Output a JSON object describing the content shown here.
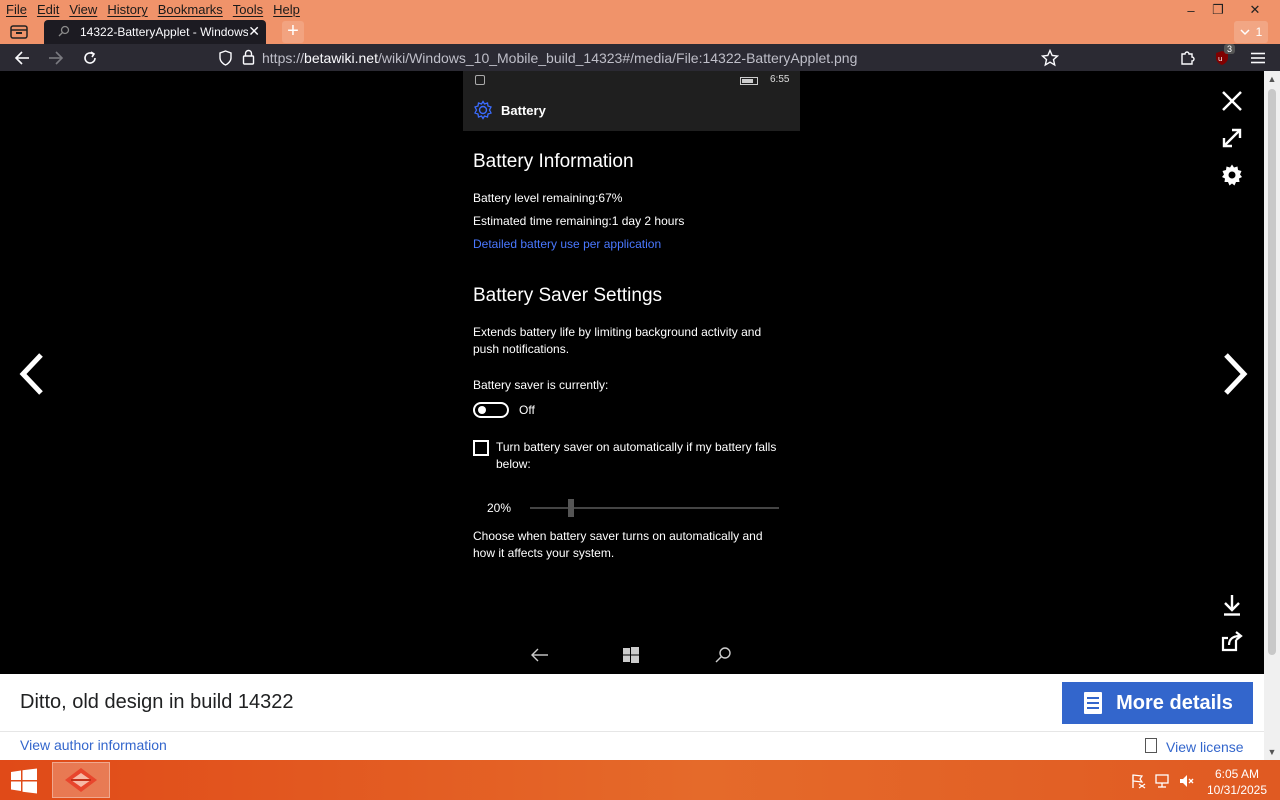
{
  "menubar": {
    "items": [
      "File",
      "Edit",
      "View",
      "History",
      "Bookmarks",
      "Tools",
      "Help"
    ]
  },
  "window_controls": {
    "minimize": "–",
    "restore": "❐",
    "close": "✕"
  },
  "tabs": [
    {
      "title": "14322-BatteryApplet - Windows",
      "close": "✕"
    }
  ],
  "new_tab_label": "+",
  "tab_count": "1",
  "nav": {
    "url_prefix": "https://",
    "url_domain": "betawiki.net",
    "url_path": "/wiki/Windows_10_Mobile_build_14323#/media/File:14322-BatteryApplet.png",
    "ublock_count": "3"
  },
  "phone": {
    "status_time": "6:55",
    "app_title": "Battery",
    "battery_info_heading": "Battery Information",
    "level_remaining": "Battery level remaining:67%",
    "time_remaining": "Estimated time remaining:1 day 2 hours",
    "detailed_link": "Detailed battery use per application",
    "saver_heading": "Battery Saver Settings",
    "saver_description_1": "Extends battery life by limiting background activity and",
    "saver_description_2": "push notifications.",
    "saver_status_label": "Battery saver is currently:",
    "toggle_state": "Off",
    "auto_checkbox_label_1": "Turn battery saver on automatically if my battery falls",
    "auto_checkbox_label_2": "below:",
    "slider_value": "20%",
    "slider_fraction": 0.2,
    "choose_text_1": "Choose when battery saver turns on automatically and",
    "choose_text_2": "how it affects your system."
  },
  "caption": {
    "title": "Ditto, old design in build 14322",
    "more_details": "More details",
    "author_link": "View author information",
    "license_link": "View license"
  },
  "taskbar": {
    "time": "6:05 AM",
    "date": "10/31/2025"
  },
  "colors": {
    "firefox_chrome": "#f0936a",
    "nav_bar": "#2b2a33",
    "link_blue": "#3366cc",
    "phone_link": "#4a78ff",
    "taskbar": "#e04a18"
  }
}
